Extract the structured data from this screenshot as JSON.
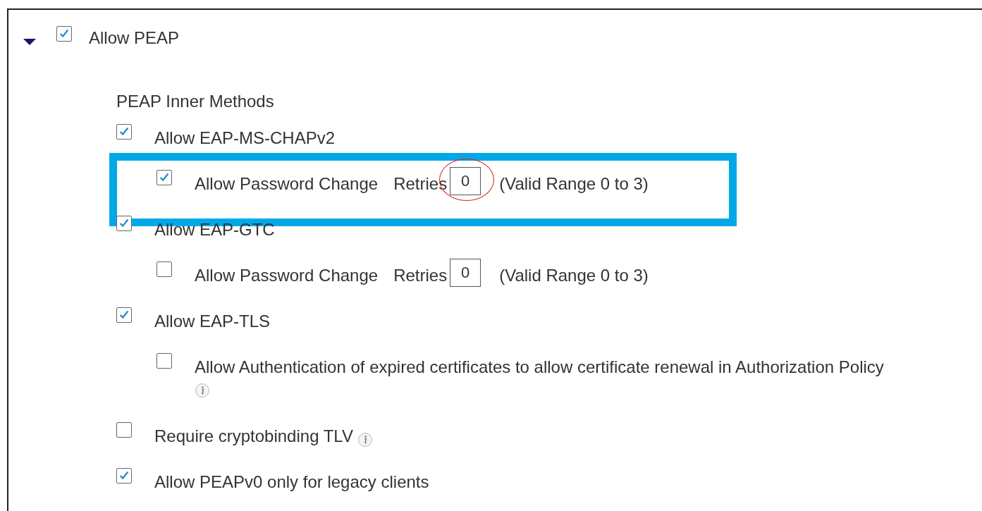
{
  "section": {
    "label": "Allow PEAP",
    "checked": true,
    "expanded": true
  },
  "heading": "PEAP Inner Methods",
  "options": [
    {
      "label": "Allow EAP-MS-CHAPv2",
      "checked": true,
      "info": false,
      "children": [
        {
          "kind": "retries",
          "label": "Allow Password Change",
          "checked": true,
          "retries_label": "Retries",
          "value": "0",
          "range": "(Valid Range 0 to 3)",
          "highlighted": true,
          "circled": true
        }
      ]
    },
    {
      "label": "Allow EAP-GTC",
      "checked": true,
      "info": false,
      "children": [
        {
          "kind": "retries",
          "label": "Allow Password Change",
          "checked": false,
          "retries_label": "Retries",
          "value": "0",
          "range": "(Valid Range 0 to 3)",
          "highlighted": false,
          "circled": false
        }
      ]
    },
    {
      "label": "Allow EAP-TLS",
      "checked": true,
      "info": false,
      "children": [
        {
          "kind": "checkbox",
          "label": "Allow Authentication of expired certificates to allow certificate renewal in Authorization Policy",
          "checked": false,
          "info": true
        }
      ]
    },
    {
      "label": "Require cryptobinding TLV",
      "checked": false,
      "info": true
    },
    {
      "label": "Allow PEAPv0 only for legacy clients",
      "checked": true,
      "info": false
    }
  ]
}
